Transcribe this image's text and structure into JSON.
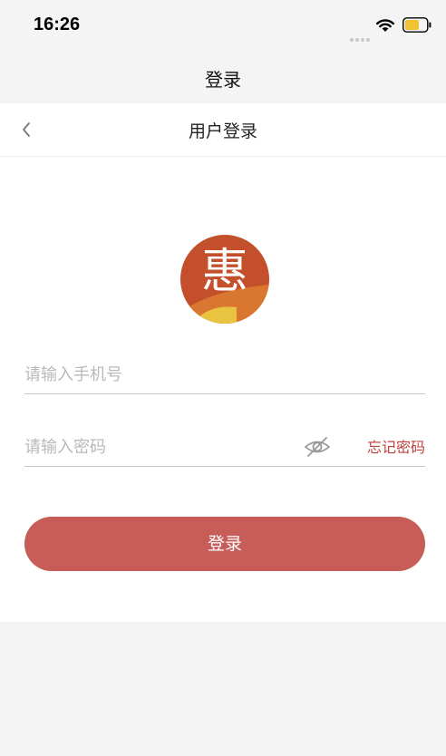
{
  "status_bar": {
    "time": "16:26",
    "icons": [
      "signal-dots-icon",
      "wifi-icon",
      "battery-icon"
    ],
    "battery_color": "#f1c232"
  },
  "header": {
    "title": "登录"
  },
  "nav": {
    "back_icon": "chevron-left-icon",
    "title": "用户登录"
  },
  "logo": {
    "glyph": "惠",
    "colors": {
      "primary": "#c4502b",
      "accent": "#e8c440"
    }
  },
  "form": {
    "phone": {
      "placeholder": "请输入手机号",
      "value": ""
    },
    "password": {
      "placeholder": "请输入密码",
      "value": "",
      "toggle_icon": "eye-off-icon",
      "forgot_label": "忘记密码"
    },
    "submit_label": "登录"
  },
  "colors": {
    "accent": "#c75c59",
    "link": "#c0413c",
    "background": "#f4f4f4"
  }
}
